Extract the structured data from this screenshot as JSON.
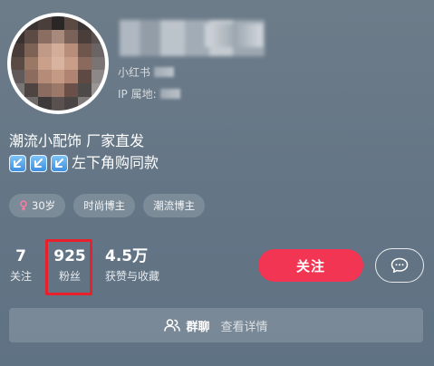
{
  "profile": {
    "platform_label": "小红书",
    "ip_label": "IP 属地:",
    "bio_line1": "潮流小配饰 厂家直发",
    "bio_line2_text": "左下角购同款"
  },
  "tags": [
    {
      "label": "30岁",
      "icon": "female-icon"
    },
    {
      "label": "时尚博主"
    },
    {
      "label": "潮流博主"
    }
  ],
  "stats": {
    "following": {
      "value": "7",
      "label": "关注"
    },
    "fans": {
      "value": "925",
      "label": "粉丝"
    },
    "likes": {
      "value": "4.5万",
      "label": "获赞与收藏"
    }
  },
  "actions": {
    "follow_label": "关注",
    "message_icon": "chat-bubble-icon"
  },
  "group_bar": {
    "label": "群聊",
    "detail": "查看详情",
    "icon": "group-users-icon"
  },
  "colors": {
    "follow_button": "#f23553",
    "highlight_box": "#e8202c",
    "arrow_emoji": "#3d8fe0"
  }
}
